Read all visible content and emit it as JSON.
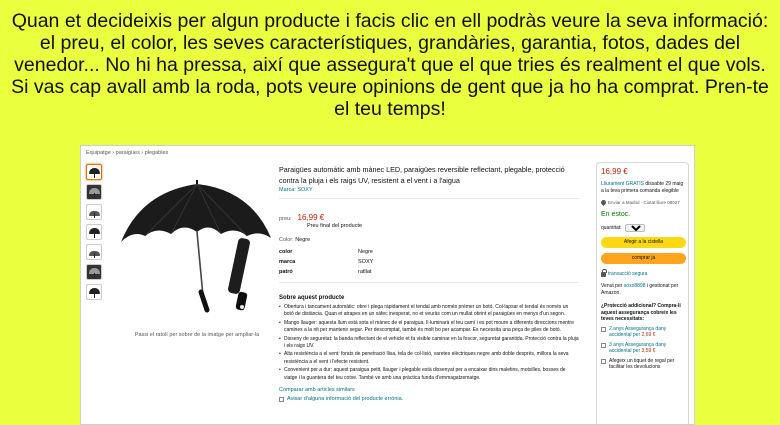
{
  "instruction": "Quan et decideixis per algun producte i facis clic en ell podràs veure la seva informació: el preu, el color, les seves característiques, grandàries, garantia, fotos, dades del venedor... No hi ha pressa, així que assegura't que el que tries és realment el que vols. Si vas cap avall amb la roda, pots veure opinions de gent que ja ho ha comprat. Pren-te el teu temps!",
  "page": {
    "breadcrumb": "Equipatge › paraigües › plegables",
    "image_caption": "Passi el ratolí per sobre de la imatge per ampliar-la",
    "title": "Paraigües automàtic amb mànec LED, paraigües reversible reflectant, plegable, protecció contra la pluja i els raigs UV, resistent a el vent i a l'aigua",
    "brand": "Marca: SOXY",
    "price_label": "preu:",
    "price": "16,99 €",
    "price_info": "Preu final del producte",
    "color_label": "Color:",
    "color_value": "Negre",
    "specs": [
      {
        "k": "color",
        "v": "Negre"
      },
      {
        "k": "marca",
        "v": "SOXY"
      },
      {
        "k": "patró",
        "v": "ratllat"
      }
    ],
    "about_heading": "Sobre aquest producte",
    "bullets": [
      "Obertura i tancament automàtic: obre i plega ràpidament el tendal amb només prémer un botó. Col·lapsar el tendal és només un botó de distància. Quan et atrapes en un xàfec inesperat, no et veuràs com un mullat obrint el paraigües en menys d'un segon.",
      "Mango llauger: aquesta llum està sota el mànec de el paraigua. Il·luminarà el teu camí i es pot moure a diferents direccions mentre camines a la nit per mantenir segur. Per descomptat, també és molt bo per acampar. Es necessita una peça de piles de botó.",
      "Disseny de seguretat: la banda reflectant de el vehicle et fa visible caminar en la foscor, seguretat garantida. Protecció contra la pluja i els raigs UV.",
      "Alta resistència a el vent: forats de penetració llisa, tela de col·lisió, varetes elèctriques negre amb doble desprès, millora la seva resistència a el vent i l'efecte resistent.",
      "Convenient per a dur: aquest paraigua petit, llauger i plegable està dissenyat per a encaixar dins maletins, motxilles, bosses de viatge i la guantera del teu cotxe. També ve amb una pràctica funda d'emmagatzematge."
    ],
    "compare": "Comparar amb articles similars",
    "report": "Avisar d'alguna informació del producte errònia."
  },
  "buybox": {
    "price": "16,99 €",
    "delivery_prefix": "Lliurament GRATIS",
    "delivery_text": "dissabte 29 maig a la teva primera comanda elegible",
    "location": "Enviar a Madrid · Ciutat lliure 08027",
    "stock": "En estoc.",
    "qty_label": "quantitat:",
    "qty_value": "1",
    "add_to_cart": "Afegir a la cistella",
    "buy_now": "comprar ja",
    "secure": "transacció segura",
    "seller_text": "Venut per",
    "seller_name": "soxo8898",
    "seller_rest": "i gestionat per Amazon.",
    "protection_heading": "¿Protecció addicional? Compra-li aquest assegurança cobreix les teves necessitats:",
    "options": [
      {
        "text": "2 anys Assegurança dany accidental per",
        "price": "2,69 €"
      },
      {
        "text": "3 anys Assegurança dany accidental per",
        "price": "3,59 €"
      },
      {
        "text": "Afegeix un tiquet de regal per facilitar les devolucions",
        "price": ""
      }
    ]
  }
}
